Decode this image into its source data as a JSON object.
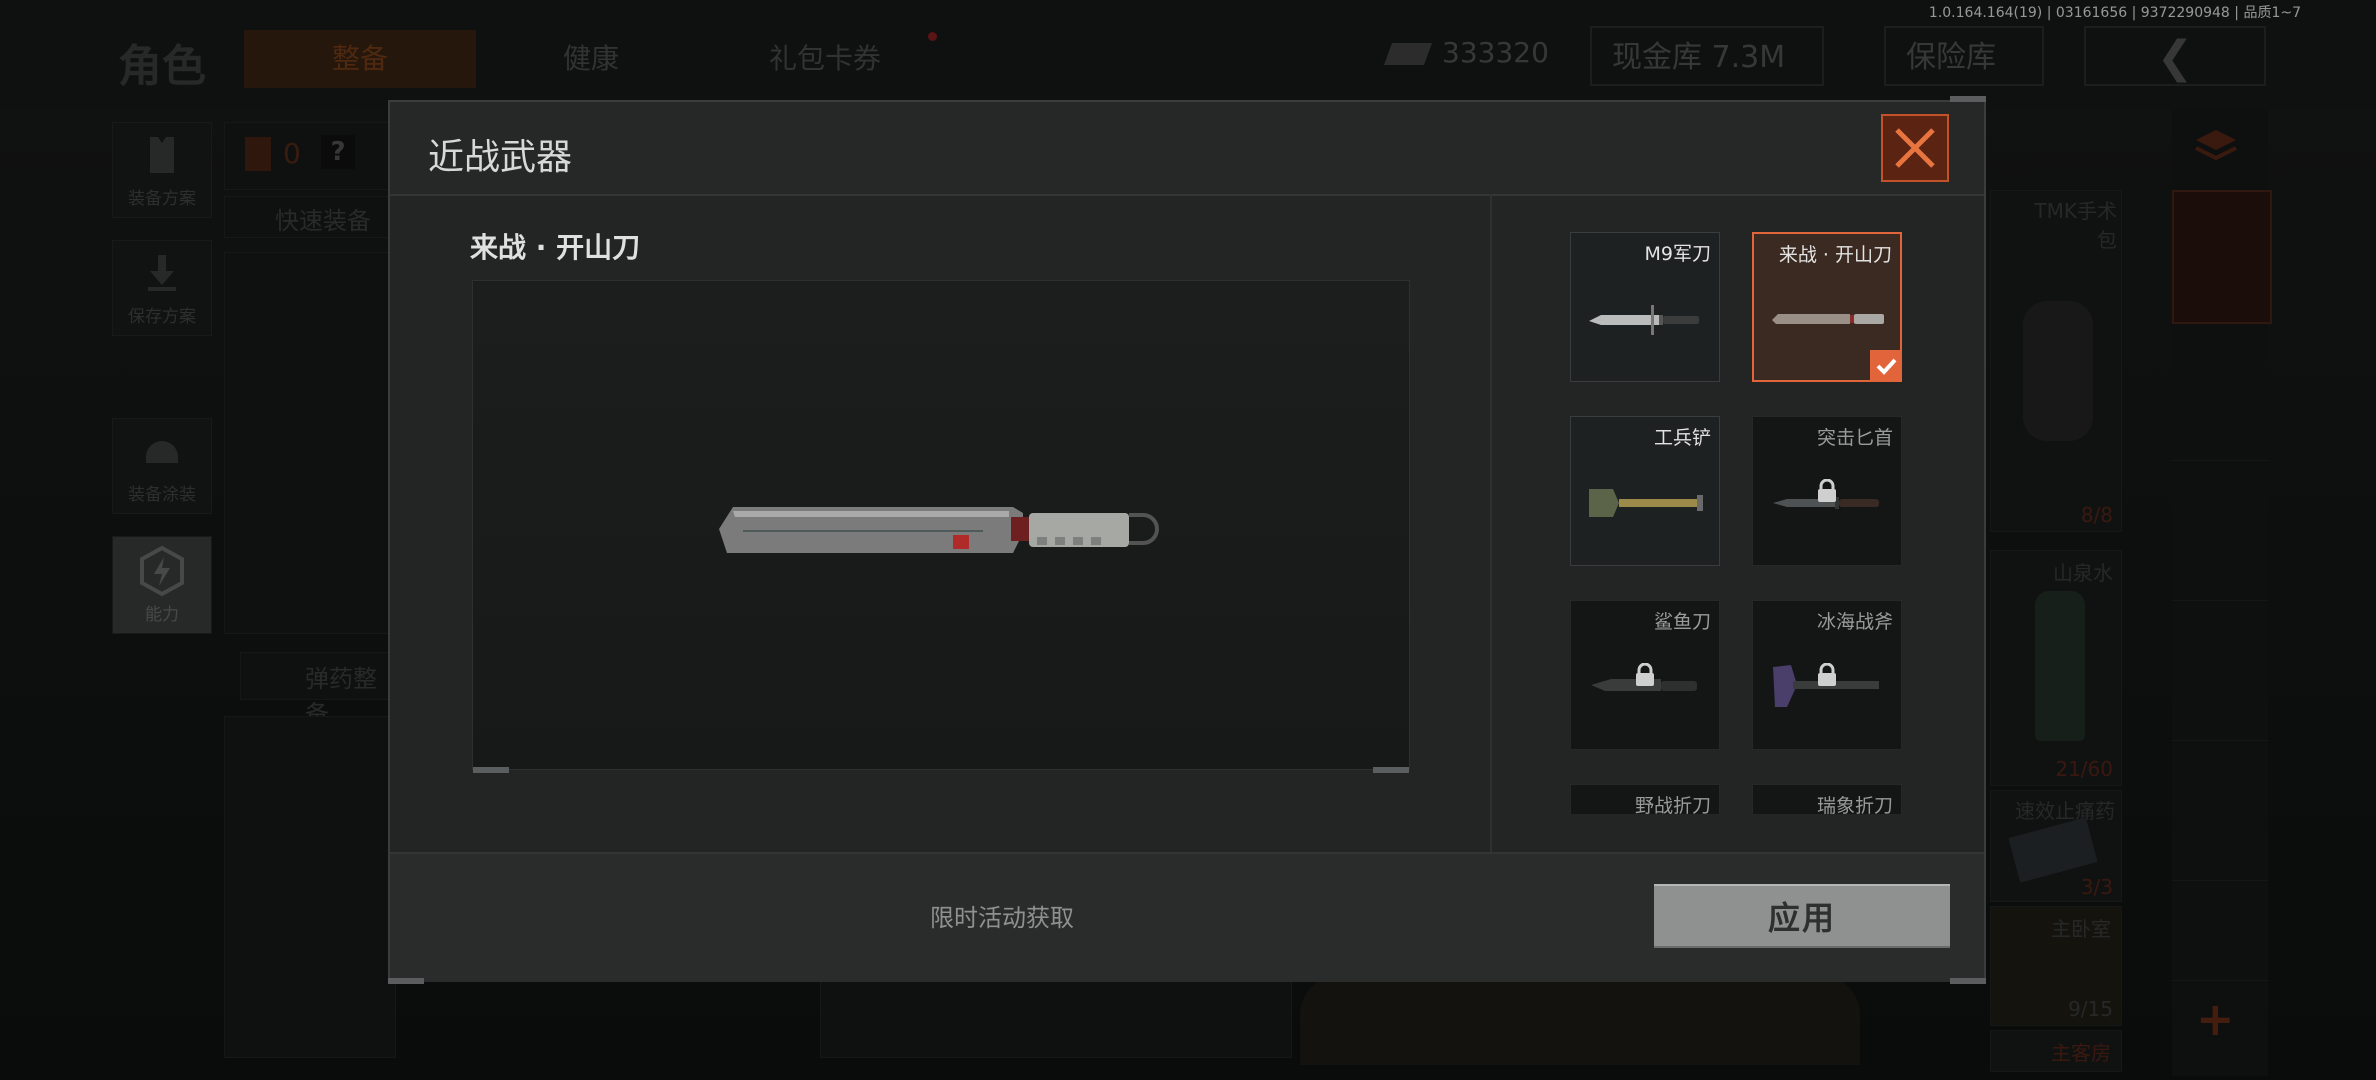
{
  "version": "1.0.164.164(19) | 03161656 | 9372290948 | 品质1~7",
  "background": {
    "page_title": "角色",
    "nav_tabs": [
      "整备",
      "健康",
      "礼包卡券"
    ],
    "currency": "333320",
    "vault_label": "现金库 7.3M",
    "safe_label": "保险库",
    "left_items": [
      "装备方案",
      "保存方案",
      "装备涂装",
      "能力"
    ],
    "quick_equip": "快速装备",
    "ammo_equip": "弹药整备",
    "backpack_count": "0",
    "help": "?",
    "inventory": [
      {
        "name": "TMK手术包",
        "count": "8/8"
      },
      {
        "name": "山泉水",
        "count": "21/60"
      },
      {
        "name": "速效止痛药",
        "count": "3/3"
      },
      {
        "name": "主卧室",
        "count": "9/15"
      },
      {
        "name": "主客房",
        "count": ""
      }
    ]
  },
  "modal": {
    "title": "近战武器",
    "preview_name": "来战 · 开山刀",
    "footer_note": "限时活动获取",
    "apply_label": "应用",
    "weapons": [
      {
        "name": "M9军刀",
        "locked": false,
        "selected": false
      },
      {
        "name": "来战 · 开山刀",
        "locked": false,
        "selected": true
      },
      {
        "name": "工兵铲",
        "locked": false,
        "selected": false
      },
      {
        "name": "突击匕首",
        "locked": true,
        "selected": false
      },
      {
        "name": "鲨鱼刀",
        "locked": true,
        "selected": false
      },
      {
        "name": "冰海战斧",
        "locked": true,
        "selected": false
      },
      {
        "name": "野战折刀",
        "locked": true,
        "selected": false
      },
      {
        "name": "瑞象折刀",
        "locked": true,
        "selected": false
      }
    ]
  },
  "colors": {
    "accent": "#e2643a",
    "apply_button": "#8f9090"
  }
}
